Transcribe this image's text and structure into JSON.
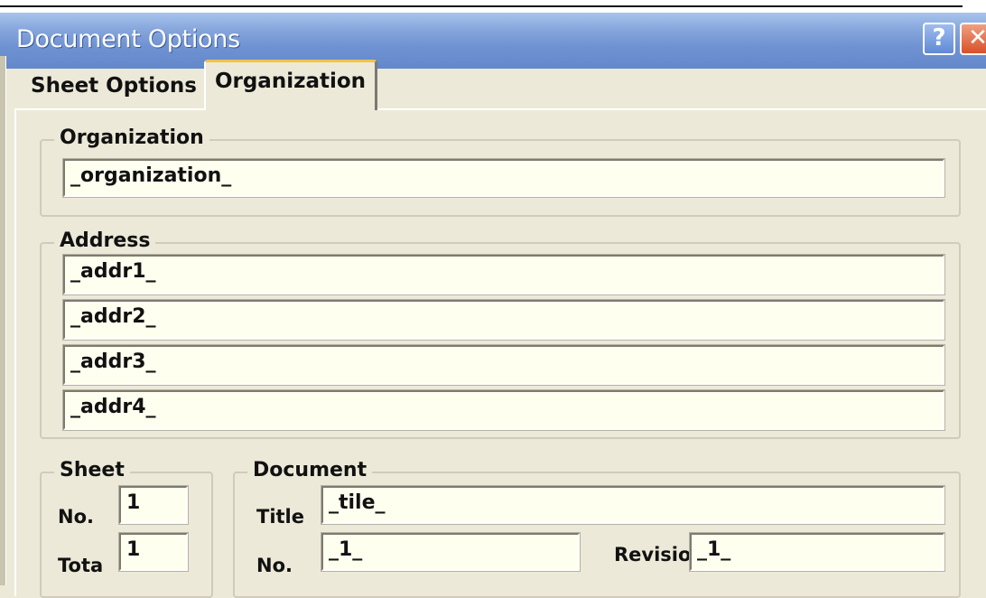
{
  "window": {
    "title": "Document Options",
    "help_glyph": "?",
    "close_glyph": "✕"
  },
  "tabs": [
    {
      "label": "Sheet Options",
      "active": false
    },
    {
      "label": "Organization",
      "active": true
    }
  ],
  "organization": {
    "label": "Organization",
    "value": "_organization_"
  },
  "address": {
    "label": "Address",
    "lines": [
      "_addr1_",
      "_addr2_",
      "_addr3_",
      "_addr4_"
    ]
  },
  "sheet": {
    "label": "Sheet",
    "no_label": "No.",
    "no_value": "1",
    "total_label": "Tota",
    "total_value": "1"
  },
  "document": {
    "label": "Document",
    "title_label": "Title",
    "title_value": "_tile_",
    "no_label": "No.",
    "no_value": "_1_",
    "revision_label": "Revisio",
    "revision_value": "_1_"
  }
}
